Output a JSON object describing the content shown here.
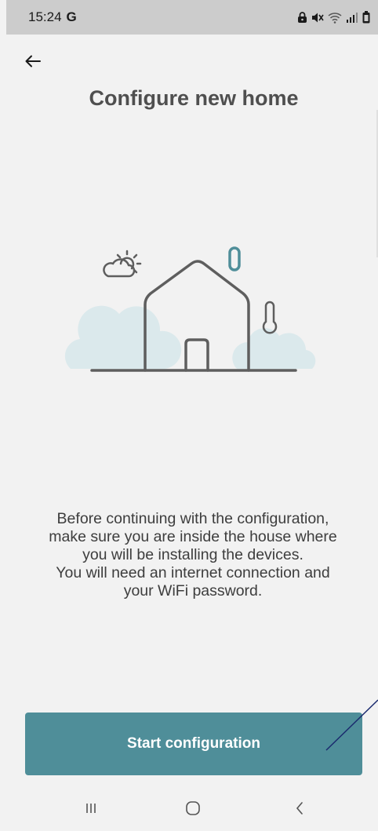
{
  "status_bar": {
    "time": "15:24",
    "g_letter": "G",
    "icons": [
      "lock-icon",
      "mute-icon",
      "wifi-icon",
      "signal-icon",
      "battery-icon"
    ]
  },
  "header": {
    "back_icon": "arrow-left-icon",
    "title": "Configure new home"
  },
  "illustration": {
    "icons": [
      "weather-icon",
      "house-icon",
      "thermometer-icon",
      "sensor-icon",
      "cloud-icon"
    ],
    "accent_color": "#4f8e99"
  },
  "description": {
    "lines": [
      "Before continuing with the configuration,",
      "make sure you are inside the house where",
      "you will be installing the devices.",
      "You will need an internet connection and",
      "your WiFi password."
    ]
  },
  "start_button": {
    "label": "Start configuration",
    "color": "#4f8e99"
  },
  "nav_bar": {
    "recents_icon": "recents-icon",
    "home_icon": "home-icon",
    "back_icon": "back-chevron-icon"
  }
}
